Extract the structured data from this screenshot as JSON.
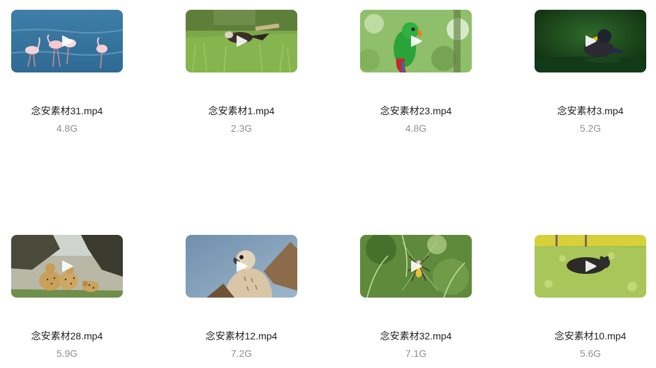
{
  "files": [
    {
      "name": "念安素材31.mp4",
      "size": "4.8G",
      "subject": "flamingos"
    },
    {
      "name": "念安素材1.mp4",
      "size": "2.3G",
      "subject": "eagle-in-grass"
    },
    {
      "name": "念安素材23.mp4",
      "size": "4.8G",
      "subject": "parrot"
    },
    {
      "name": "念安素材3.mp4",
      "size": "5.2G",
      "subject": "duck"
    },
    {
      "name": "念安素材28.mp4",
      "size": "5.9G",
      "subject": "cheetahs"
    },
    {
      "name": "念安素材12.mp4",
      "size": "7.2G",
      "subject": "falcon"
    },
    {
      "name": "念安素材32.mp4",
      "size": "7.1G",
      "subject": "spider"
    },
    {
      "name": "念安素材10.mp4",
      "size": "5.6G",
      "subject": "bear"
    }
  ],
  "icons": {
    "play": "play-icon"
  }
}
